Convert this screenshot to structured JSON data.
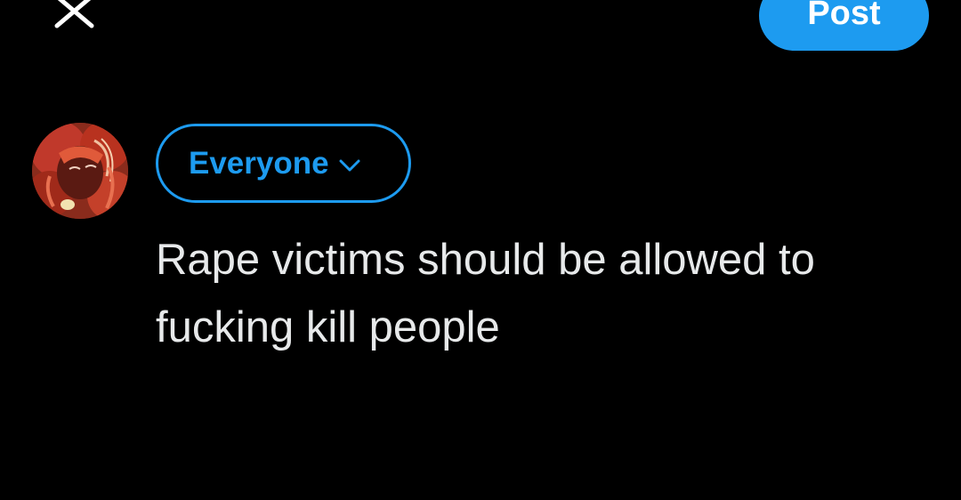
{
  "toolbar": {
    "close_icon": "close-icon",
    "post_label": "Post"
  },
  "composer": {
    "avatar_icon": "user-avatar",
    "audience_label": "Everyone",
    "audience_icon": "chevron-down-icon",
    "text": "Rape victims should be allowed to fucking kill people"
  },
  "colors": {
    "background": "#000000",
    "accent": "#1d9bf0",
    "text": "#e7e9ea"
  }
}
